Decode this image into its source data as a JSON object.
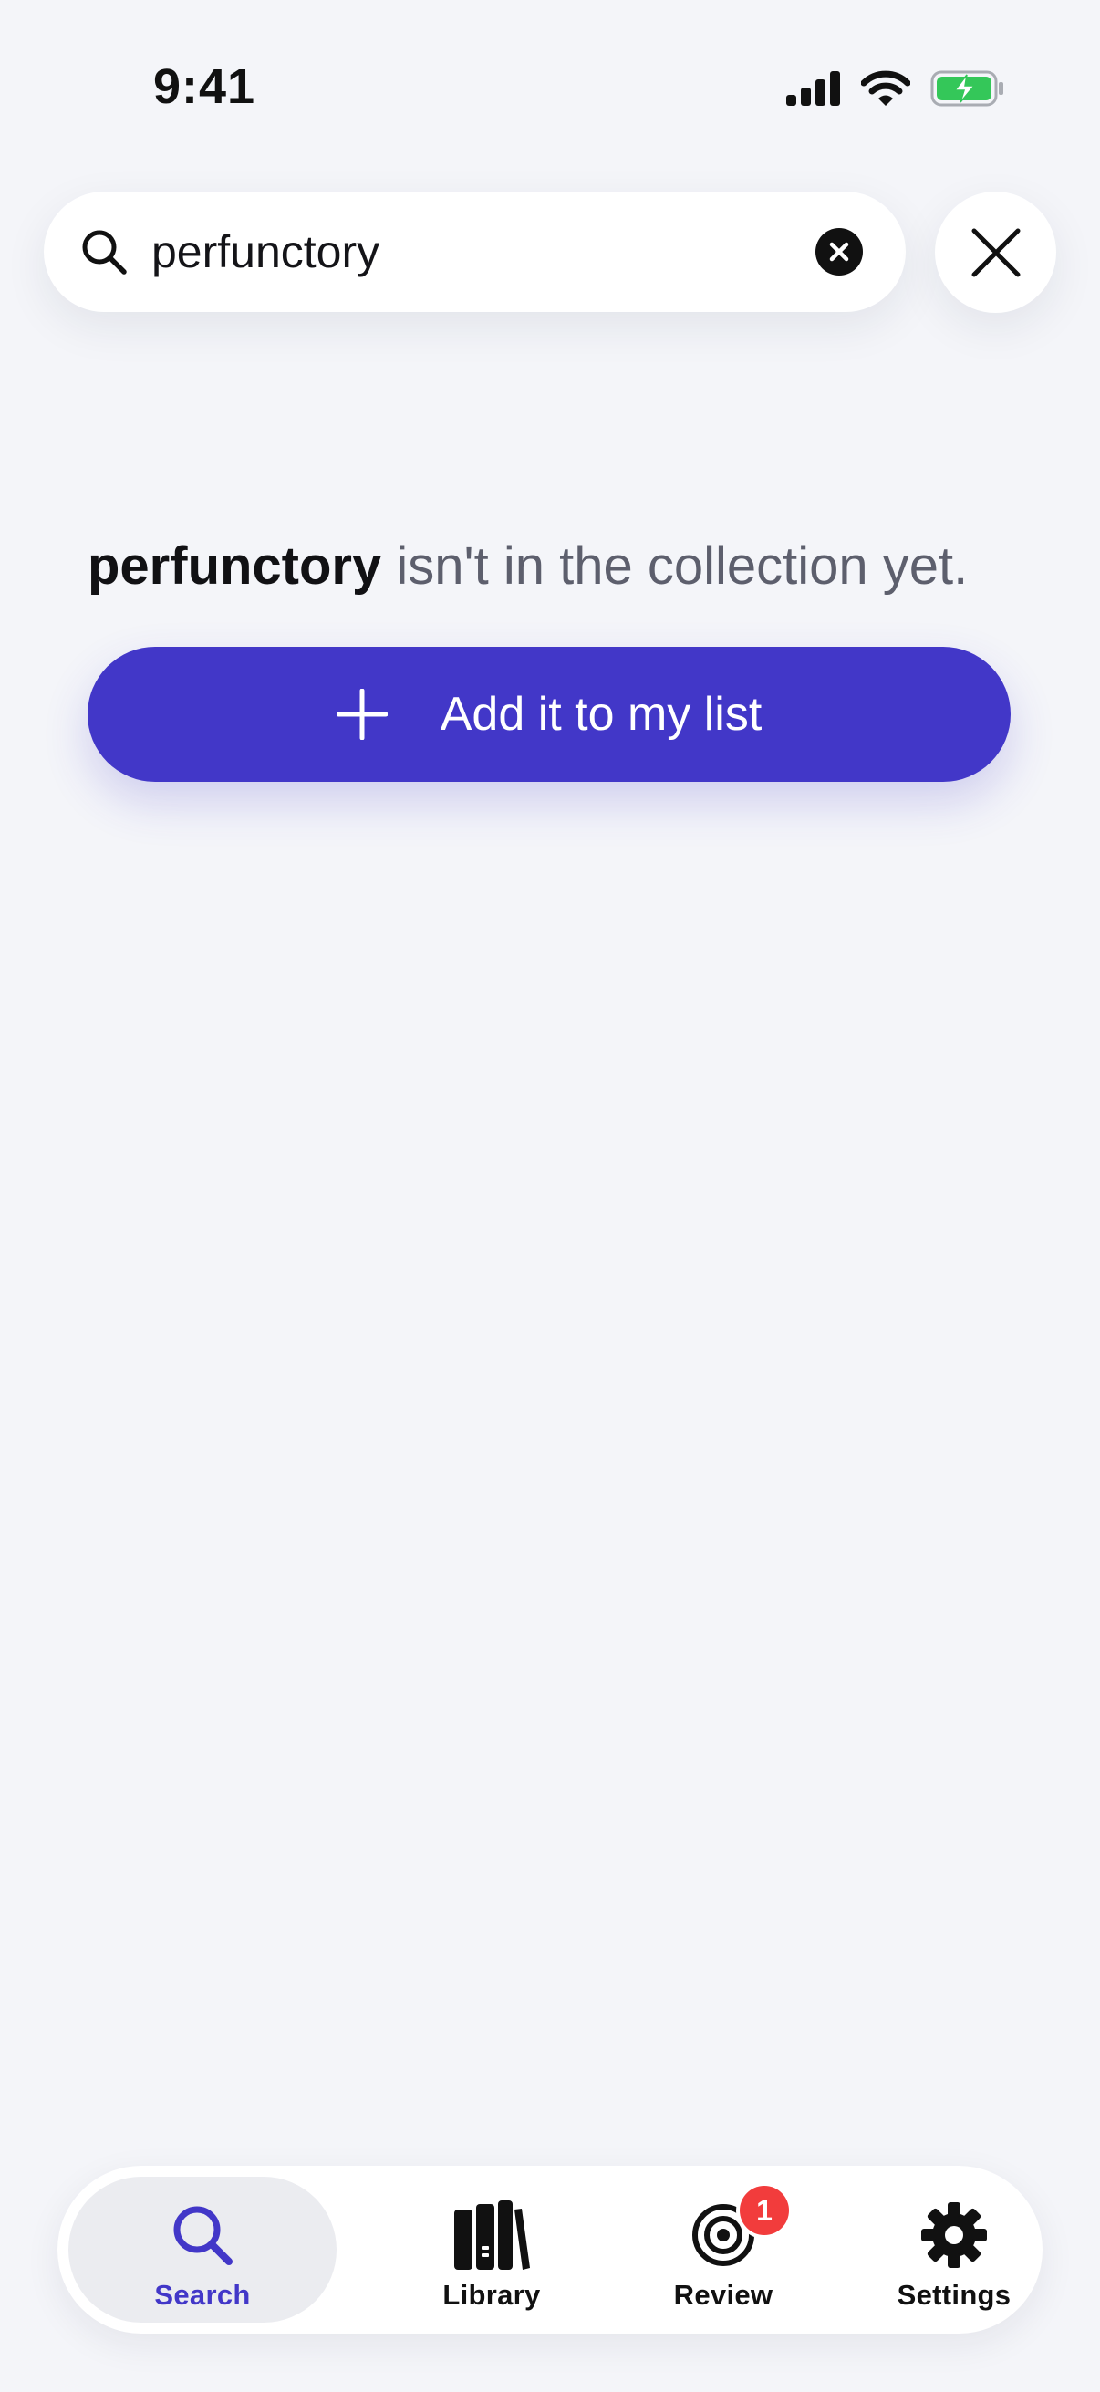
{
  "status_bar": {
    "time": "9:41"
  },
  "search": {
    "query": "perfunctory"
  },
  "empty_state": {
    "term": "perfunctory",
    "message": " isn't in the collection yet.",
    "add_button_label": "Add it to my list"
  },
  "tabs": [
    {
      "label": "Search",
      "icon": "search-icon",
      "active": true
    },
    {
      "label": "Library",
      "icon": "books-icon",
      "active": false
    },
    {
      "label": "Review",
      "icon": "target-icon",
      "active": false,
      "badge": "1"
    },
    {
      "label": "Settings",
      "icon": "gear-icon",
      "active": false
    }
  ],
  "colors": {
    "accent": "#4237c8",
    "background": "#f4f5f9",
    "badge": "#f23c3c",
    "battery": "#34c759"
  }
}
